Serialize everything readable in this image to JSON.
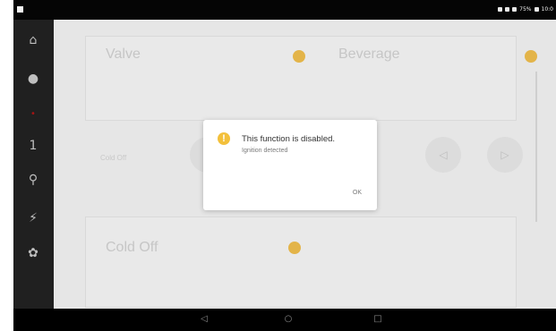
{
  "status_bar": {
    "right_text": "75%",
    "time": "10:0"
  },
  "sidebar": {
    "items": [
      {
        "icon": "home-icon",
        "glyph": "⌂"
      },
      {
        "icon": "drop-icon",
        "glyph": "●"
      },
      {
        "icon": "indicator-icon",
        "glyph": "•"
      },
      {
        "icon": "thermometer-icon",
        "glyph": "1"
      },
      {
        "icon": "pin-icon",
        "glyph": "⚲"
      },
      {
        "icon": "flash-icon",
        "glyph": "⚡"
      },
      {
        "icon": "fan-icon",
        "glyph": "✿"
      }
    ]
  },
  "cards": {
    "top_left_title": "Valve",
    "top_right_title": "Beverage",
    "bottom_left_title": "Cold Off",
    "left_label": "Cold Off"
  },
  "dialog": {
    "title": "This function is disabled.",
    "message": "Ignition detected",
    "ok_label": "OK"
  },
  "navbar": {
    "back_glyph": "◁",
    "home_glyph": "○",
    "recents_glyph": "□"
  },
  "colors": {
    "warning": "#f3c03b",
    "sidebar_bg": "#202020",
    "overlay_bg": "#e6e6e6"
  }
}
